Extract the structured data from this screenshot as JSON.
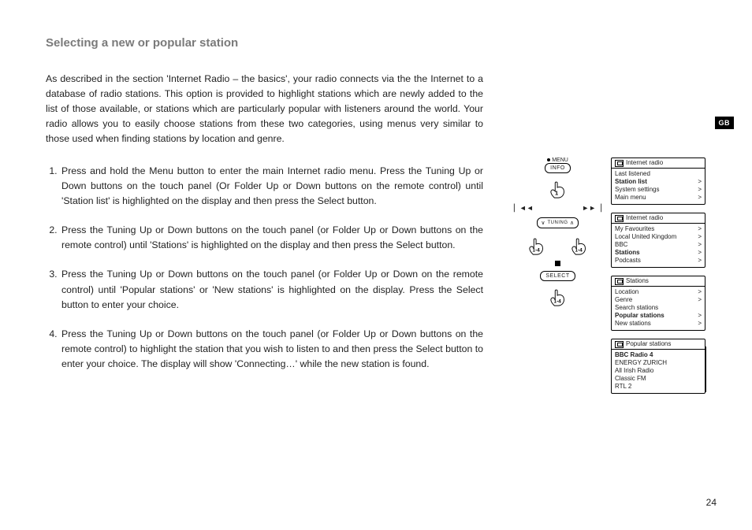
{
  "language_tab": "GB",
  "page_number": "24",
  "heading": "Selecting a new or popular station",
  "intro": "As described in the section 'Internet Radio – the basics', your radio connects via the the Internet to a database of radio stations. This option is provided to highlight stations which are newly added to the list of those available, or stations which are particularly popular with listeners around the world. Your radio allows you to easily choose stations from these two categories, using menus very similar to those used when finding stations by location and genre.",
  "steps": [
    "Press and hold the Menu button to enter the main Internet radio menu. Press the Tuning Up or Down buttons on the touch panel (Or Folder Up or Down buttons on the remote control) until 'Station list' is highlighted on the display and then press the Select button.",
    "Press the Tuning Up or Down buttons on the touch panel (or Folder Up or Down buttons on the remote control) until 'Stations' is highlighted on the display and then press the Select button.",
    "Press the Tuning Up or Down buttons on the touch panel (or Folder Up or Down on the remote control) until 'Popular stations' or 'New stations' is highlighted on the display. Press the Select button to enter your choice.",
    "Press the Tuning Up or Down buttons on the touch panel (or Folder Up or Down buttons on the remote control) to highlight the station that you wish to listen to and then press the Select button to enter your choice. The display will show 'Connecting…' while the new station is found."
  ],
  "diagram": {
    "menu_label": "MENU",
    "info_label": "INFO",
    "tuning_label": "TUNING",
    "select_label": "SELECT",
    "step_1": "1",
    "steps_1_4": "1-4",
    "prev_symbol": "▏◄◄",
    "next_symbol": "►►▕",
    "down_symbol": "∨",
    "up_symbol": "∧"
  },
  "screens": {
    "s1": {
      "title": "Internet radio",
      "items": [
        {
          "label": "Last listened",
          "chev": "",
          "bold": false
        },
        {
          "label": "Station list",
          "chev": ">",
          "bold": true
        },
        {
          "label": "System settings",
          "chev": ">",
          "bold": false
        },
        {
          "label": "Main menu",
          "chev": ">",
          "bold": false
        }
      ]
    },
    "s2": {
      "title": "Internet radio",
      "items": [
        {
          "label": "My Favourites",
          "chev": ">",
          "bold": false
        },
        {
          "label": "Local United Kingdom",
          "chev": ">",
          "bold": false
        },
        {
          "label": "BBC",
          "chev": ">",
          "bold": false
        },
        {
          "label": "Stations",
          "chev": ">",
          "bold": true
        },
        {
          "label": "Podcasts",
          "chev": ">",
          "bold": false
        }
      ]
    },
    "s3": {
      "title": "Stations",
      "items": [
        {
          "label": "Location",
          "chev": ">",
          "bold": false
        },
        {
          "label": "Genre",
          "chev": ">",
          "bold": false
        },
        {
          "label": "Search stations",
          "chev": "",
          "bold": false
        },
        {
          "label": "Popular stations",
          "chev": ">",
          "bold": true
        },
        {
          "label": "New stations",
          "chev": ">",
          "bold": false
        }
      ]
    },
    "s4": {
      "title": "Popular stations",
      "items": [
        {
          "label": "BBC Radio 4",
          "chev": "",
          "bold": true
        },
        {
          "label": "ENERGY ZURICH",
          "chev": "",
          "bold": false
        },
        {
          "label": "All Irish Radio",
          "chev": "",
          "bold": false
        },
        {
          "label": "Classic FM",
          "chev": "",
          "bold": false
        },
        {
          "label": "RTL 2",
          "chev": "",
          "bold": false
        }
      ]
    }
  }
}
